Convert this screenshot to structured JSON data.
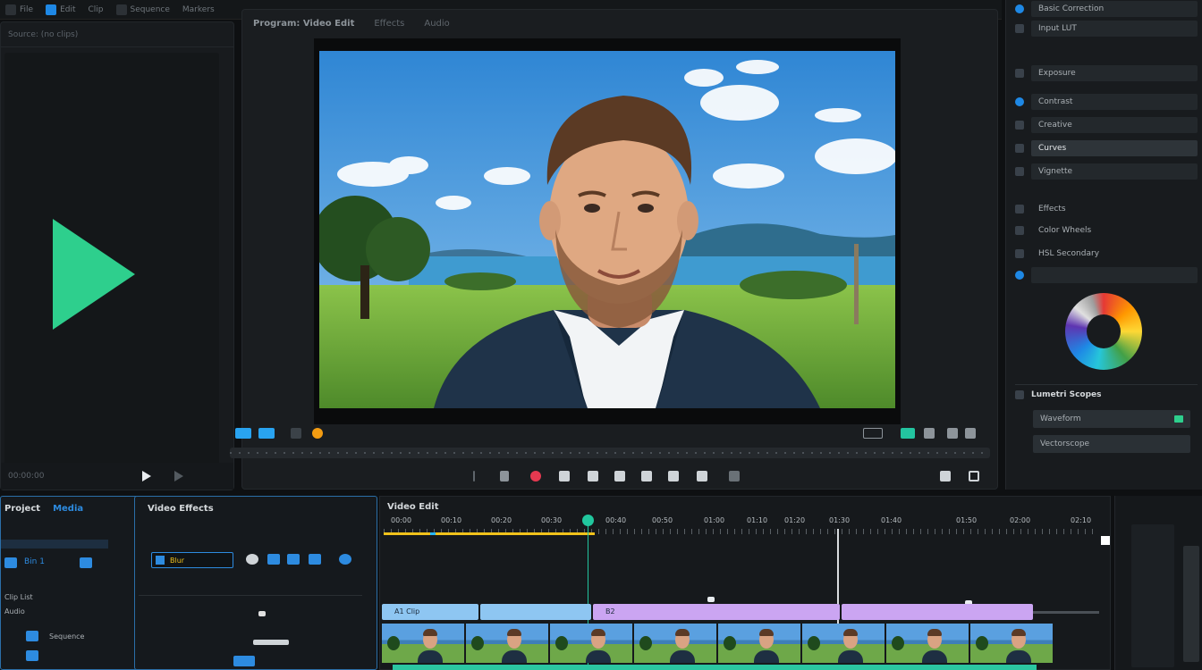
{
  "top_bar": {
    "items": [
      "File",
      "Edit",
      "Clip",
      "Sequence",
      "Markers"
    ]
  },
  "left_panel": {
    "header": "Source: (no clips)",
    "footer_label": "00:00:00"
  },
  "program_monitor": {
    "tabs": [
      "Program: Video Edit",
      "Effects",
      "Audio"
    ]
  },
  "inspector": {
    "rows": [
      {
        "label": "Basic Correction",
        "selected": false
      },
      {
        "label": "Input LUT",
        "selected": false
      },
      {
        "label": "Exposure",
        "selected": false
      },
      {
        "label": "Contrast",
        "selected": false
      },
      {
        "label": "Creative",
        "selected": false
      },
      {
        "label": "Curves",
        "selected": true
      },
      {
        "label": "Vignette",
        "selected": false
      },
      {
        "label": "Effects",
        "selected": false
      },
      {
        "label": "Color Wheels",
        "selected": false
      },
      {
        "label": "HSL Secondary",
        "selected": false
      }
    ],
    "lumetri_title": "Lumetri Scopes",
    "lumetri_field1": "Waveform",
    "lumetri_field2": "Vectorscope",
    "colors": {
      "accent": "#2ecf8d",
      "blue": "#1e88e5"
    }
  },
  "project_panel": {
    "title": "Project",
    "tab2": "Media",
    "rows": [
      "Bin 1",
      "Clip List",
      "Audio",
      "Sequence"
    ]
  },
  "effects_panel": {
    "title": "Video Effects",
    "search_value": "Blur"
  },
  "timeline": {
    "title": "Video Edit",
    "ruler_labels": [
      "00:00",
      "00:10",
      "00:20",
      "00:30",
      "00:40",
      "00:50",
      "01:00",
      "01:10",
      "01:20",
      "01:30",
      "01:40",
      "01:50",
      "02:00",
      "02:10"
    ],
    "clips": [
      {
        "label": "A1 Clip",
        "color": "#8ec6f2"
      },
      {
        "label": "",
        "color": "#8ec6f2"
      },
      {
        "label": "B2",
        "color": "#cba5f2"
      },
      {
        "label": "",
        "color": "#cba5f2"
      }
    ],
    "thumb_count": 8
  }
}
